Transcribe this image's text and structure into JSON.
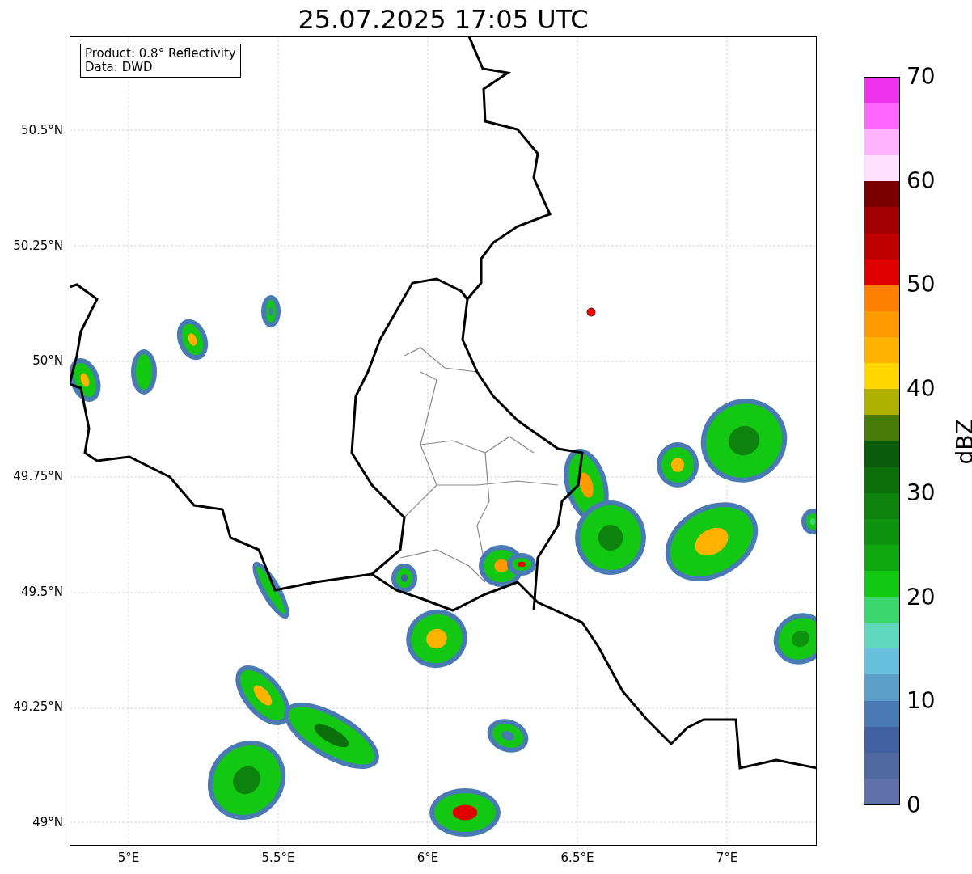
{
  "title": "25.07.2025 17:05 UTC",
  "map": {
    "legend": [
      "Product: 0.8° Reflectivity",
      "Data: DWD"
    ],
    "yticks": [
      "50.5°N",
      "50.25°N",
      "50°N",
      "49.75°N",
      "49.5°N",
      "49.25°N",
      "49°N"
    ],
    "xticks": [
      "5°E",
      "5.5°E",
      "6°E",
      "6.5°E",
      "7°E"
    ]
  },
  "colorbar": {
    "label": "dBZ",
    "ticks": [
      "70",
      "60",
      "50",
      "40",
      "30",
      "20",
      "10",
      "0"
    ],
    "bins": [
      {
        "color": "#6070a8"
      },
      {
        "color": "#5068a0"
      },
      {
        "color": "#4060a0"
      },
      {
        "color": "#4a7ab4"
      },
      {
        "color": "#5ba0c8"
      },
      {
        "color": "#68c0dc"
      },
      {
        "color": "#60d8c0"
      },
      {
        "color": "#3cd66e"
      },
      {
        "color": "#12c812"
      },
      {
        "color": "#10a810"
      },
      {
        "color": "#0e930e"
      },
      {
        "color": "#0d820d"
      },
      {
        "color": "#0b700b"
      },
      {
        "color": "#0a5c0a"
      },
      {
        "color": "#487a08"
      },
      {
        "color": "#b0b000"
      },
      {
        "color": "#ffd700"
      },
      {
        "color": "#ffb300"
      },
      {
        "color": "#ff9900"
      },
      {
        "color": "#ff7f00"
      },
      {
        "color": "#e00000"
      },
      {
        "color": "#c00000"
      },
      {
        "color": "#a00000"
      },
      {
        "color": "#7a0000"
      },
      {
        "color": "#ffe0ff"
      },
      {
        "color": "#ffb3ff"
      },
      {
        "color": "#ff66ff"
      },
      {
        "color": "#ee33ee"
      }
    ]
  }
}
